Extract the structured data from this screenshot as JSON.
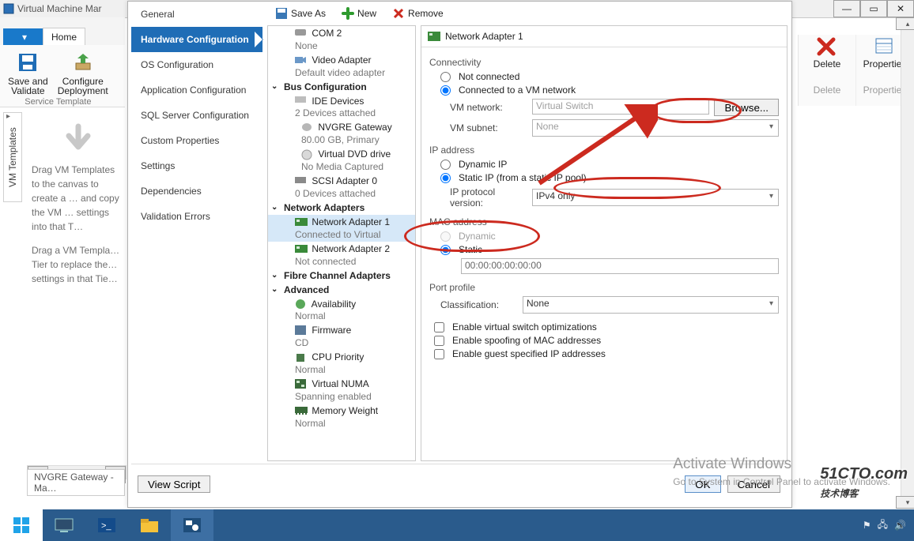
{
  "title": "Virtual Machine Mar",
  "tabs": {
    "file": "",
    "home": "Home"
  },
  "ribbon": {
    "save_validate": "Save and\nValidate",
    "configure_deploy": "Configure\nDeployment",
    "group": "Service Template"
  },
  "right_ribbon": {
    "delete_btn": "Delete",
    "properties_btn": "Properties",
    "delete_lbl": "Delete",
    "properties_lbl": "Properties"
  },
  "vtab": "VM Templates",
  "hint": {
    "para1": "Drag VM Templates to the canvas to create a … and copy the VM … settings into that T…",
    "para2": "Drag a VM Templa… Tier to replace the… settings in that Tie…"
  },
  "bottom_tab": "NVGRE Gateway - Ma…",
  "categories": [
    "General",
    "Hardware Configuration",
    "OS Configuration",
    "Application Configuration",
    "SQL Server Configuration",
    "Custom Properties",
    "Settings",
    "Dependencies",
    "Validation Errors"
  ],
  "toolbar": {
    "save_as": "Save As",
    "new": "New",
    "remove": "Remove"
  },
  "tree": {
    "com2": {
      "label": "COM 2",
      "sub": "None"
    },
    "video": {
      "label": "Video Adapter",
      "sub": "Default video adapter"
    },
    "bus_section": "Bus Configuration",
    "ide": {
      "label": "IDE Devices",
      "sub": "2 Devices attached"
    },
    "nvgre": {
      "label": "NVGRE Gateway",
      "sub": "80.00 GB, Primary"
    },
    "dvd": {
      "label": "Virtual DVD drive",
      "sub": "No Media Captured"
    },
    "scsi": {
      "label": "SCSI Adapter 0",
      "sub": "0 Devices attached"
    },
    "net_section": "Network Adapters",
    "na1": {
      "label": "Network Adapter 1",
      "sub": "Connected to Virtual"
    },
    "na2": {
      "label": "Network Adapter 2",
      "sub": "Not connected"
    },
    "fc_section": "Fibre Channel Adapters",
    "adv_section": "Advanced",
    "avail": {
      "label": "Availability",
      "sub": "Normal"
    },
    "firm": {
      "label": "Firmware",
      "sub": "CD"
    },
    "cpu": {
      "label": "CPU Priority",
      "sub": "Normal"
    },
    "numa": {
      "label": "Virtual NUMA",
      "sub": "Spanning enabled"
    },
    "mem": {
      "label": "Memory Weight",
      "sub": "Normal"
    }
  },
  "details": {
    "title": "Network Adapter 1",
    "connectivity": "Connectivity",
    "not_connected": "Not connected",
    "connected_vm": "Connected to a VM network",
    "vm_network_lbl": "VM network:",
    "vm_network_val": "Virtual Switch",
    "browse": "Browse...",
    "vm_subnet_lbl": "VM subnet:",
    "vm_subnet_val": "None",
    "ip_address": "IP address",
    "dynamic_ip": "Dynamic IP",
    "static_ip": "Static IP (from a static IP pool)",
    "ip_proto_lbl": "IP protocol version:",
    "ip_proto_val": "IPv4 only",
    "mac_address": "MAC address",
    "mac_dynamic": "Dynamic",
    "mac_static": "Static",
    "mac_value": "00:00:00:00:00:00",
    "port_profile": "Port profile",
    "classification_lbl": "Classification:",
    "classification_val": "None",
    "chk_vswitch": "Enable virtual switch optimizations",
    "chk_spoof": "Enable spoofing of MAC addresses",
    "chk_guest": "Enable guest specified IP addresses"
  },
  "footer": {
    "view_script": "View Script",
    "ok": "OK",
    "cancel": "Cancel"
  },
  "watermark": {
    "title": "Activate Windows",
    "sub": "Go to System in Control Panel to activate Windows."
  },
  "sitemark": {
    "site": "51CTO.com",
    "cn": "技术博客"
  }
}
